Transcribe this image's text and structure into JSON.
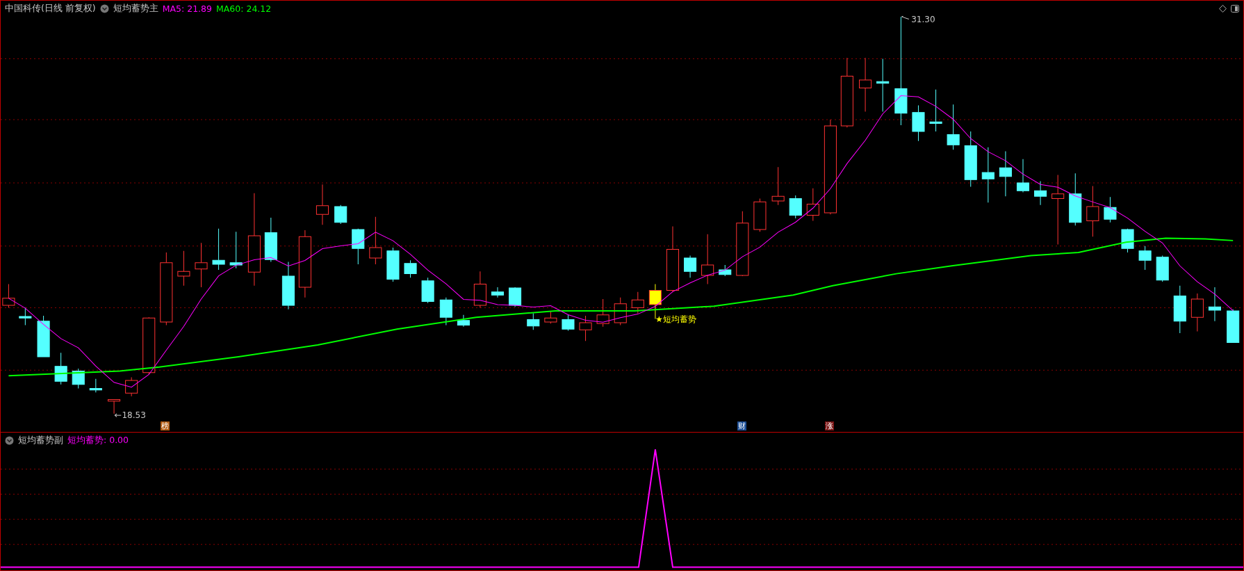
{
  "main_panel": {
    "stock_title": "中国科传(日线 前复权)",
    "indicator_name": "短均蓄势主",
    "ma_readings": [
      {
        "label": "MA5: 21.89",
        "color": "#ff00ff"
      },
      {
        "label": "MA60: 24.12",
        "color": "#00ff00"
      }
    ],
    "high_label": "31.30",
    "low_label": "18.53",
    "signal_label": "★短均蓄势",
    "event_markers": [
      {
        "text": "榜",
        "color": "#b05a10"
      },
      {
        "text": "财",
        "color": "#1d4f96"
      },
      {
        "text": "涨",
        "color": "#7a1414"
      }
    ]
  },
  "sub_panel": {
    "indicator_name": "短均蓄势副",
    "reading": "短均蓄势: 0.00"
  }
}
